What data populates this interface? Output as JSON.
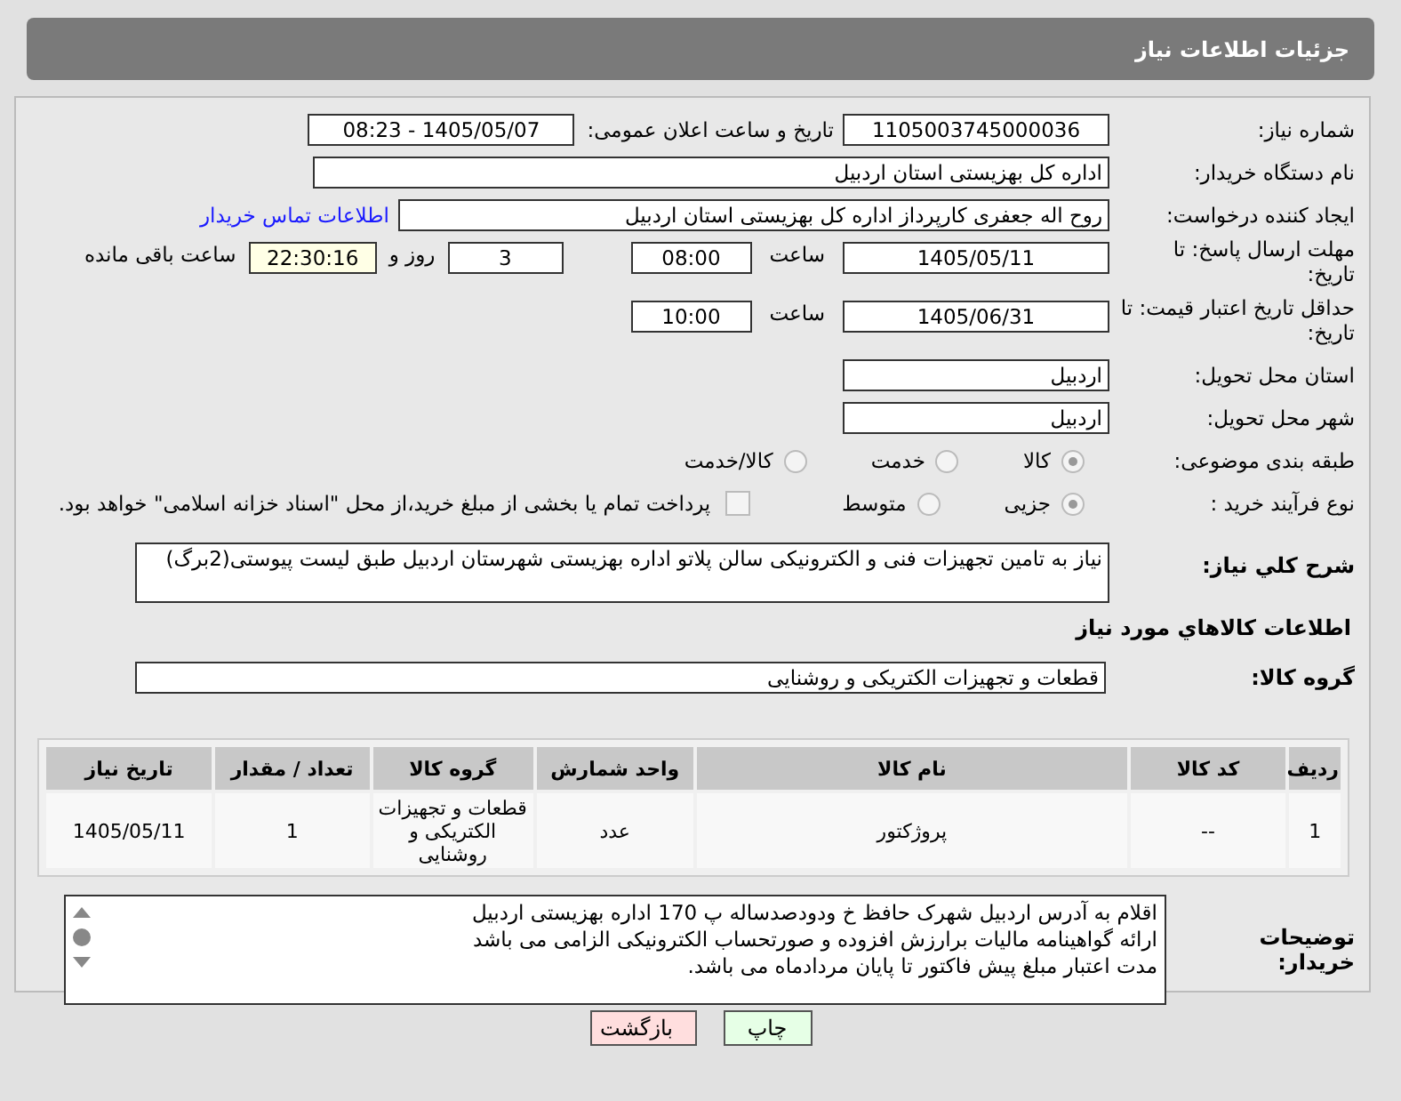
{
  "header": {
    "title": "جزئیات اطلاعات نیاز"
  },
  "need_number": {
    "label": "شماره نیاز:",
    "value": "1105003745000036"
  },
  "announce": {
    "label": "تاریخ و ساعت اعلان عمومی:",
    "value": "1405/05/07 - 08:23"
  },
  "buyer_org": {
    "label": "نام دستگاه خریدار:",
    "value": "اداره کل بهزیستی استان اردبیل"
  },
  "requester": {
    "label": "ایجاد کننده درخواست:",
    "value": "روح اله جعفری کارپرداز اداره کل بهزیستی استان اردبیل",
    "link": "اطلاعات تماس خریدار"
  },
  "reply_deadline": {
    "label": "مهلت ارسال پاسخ: تا تاریخ:",
    "date": "1405/05/11",
    "time_label": "ساعت",
    "time": "08:00",
    "days": "3",
    "days_label": "روز و",
    "remaining": "22:30:16",
    "remaining_label": "ساعت باقی مانده"
  },
  "price_validity": {
    "label": "حداقل تاریخ اعتبار قیمت: تا تاریخ:",
    "date": "1405/06/31",
    "time_label": "ساعت",
    "time": "10:00"
  },
  "delivery_province": {
    "label": "استان محل تحویل:",
    "value": "اردبیل"
  },
  "delivery_city": {
    "label": "شهر محل تحویل:",
    "value": "اردبیل"
  },
  "category": {
    "label": "طبقه بندی موضوعی:",
    "options": [
      {
        "label": "کالا",
        "selected": true
      },
      {
        "label": "خدمت",
        "selected": false
      },
      {
        "label": "کالا/خدمت",
        "selected": false
      }
    ]
  },
  "process": {
    "label": "نوع فرآیند خرید :",
    "options": [
      {
        "label": "جزیی",
        "selected": true
      },
      {
        "label": "متوسط",
        "selected": false
      }
    ],
    "payment": {
      "label": "پرداخت تمام یا بخشی از مبلغ خرید،از محل \"اسناد خزانه اسلامی\" خواهد بود.",
      "checked": false
    }
  },
  "description": {
    "label": "شرح کلي نياز:",
    "value": "نیاز به تامین تجهیزات فنی و الکترونیکی سالن پلاتو اداره بهزیستی شهرستان اردبیل طبق لیست پیوستی(2برگ)"
  },
  "goods_title": "اطلاعات کالاهاي مورد نياز",
  "goods_group": {
    "label": "گروه کالا:",
    "value": "قطعات و تجهیزات الکتریکی و روشنایی"
  },
  "table": {
    "columns": [
      "ردیف",
      "کد کالا",
      "نام کالا",
      "واحد شمارش",
      "گروه کالا",
      "تعداد / مقدار",
      "تاریخ نیاز"
    ],
    "rows": [
      [
        "1",
        "--",
        "پروژکتور",
        "عدد",
        "قطعات و تجهیزات الکتریکی و روشنایی",
        "1",
        "1405/05/11"
      ]
    ]
  },
  "notes": {
    "label": "توضیحات خریدار:",
    "lines": [
      "اقلام به آدرس اردبیل شهرک حافظ خ ودودصدساله پ 170 اداره بهزیستی اردبیل",
      "ارائه گواهینامه مالیات برارزش افزوده و صورتحساب الکترونیکی الزامی می باشد",
      "مدت اعتبار مبلغ پیش فاکتور تا پایان مردادماه می باشد."
    ]
  },
  "buttons": [
    {
      "label": "چاپ",
      "kind": "print"
    },
    {
      "label": "بازگشت",
      "kind": "back"
    }
  ]
}
